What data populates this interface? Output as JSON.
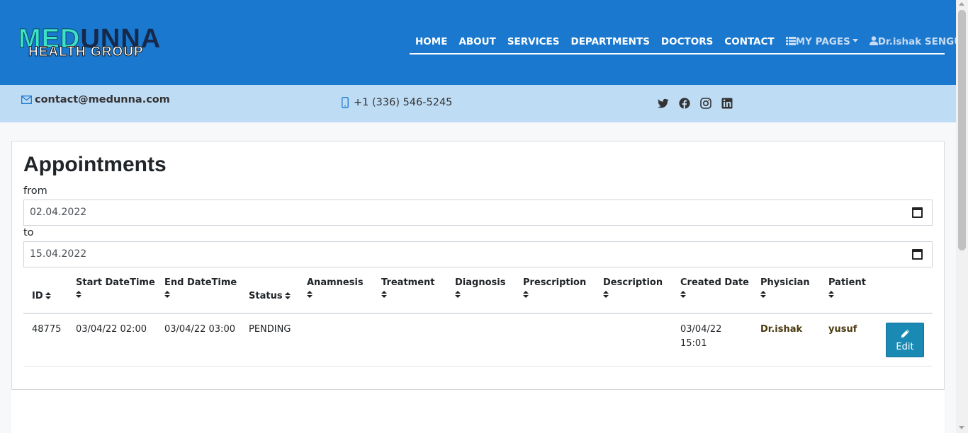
{
  "brand": {
    "logo_top_a": "MED",
    "logo_top_b": "UNNA",
    "logo_bottom": "HEALTH GROUP"
  },
  "nav": {
    "items": [
      "HOME",
      "ABOUT",
      "SERVICES",
      "DEPARTMENTS",
      "DOCTORS",
      "CONTACT"
    ],
    "my_pages": "MY PAGES",
    "user": "Dr.ishak SENGUL"
  },
  "contact": {
    "email": "contact@medunna.com",
    "phone": "+1 (336) 546-5245",
    "socials": [
      "twitter-icon",
      "facebook-icon",
      "instagram-icon",
      "linkedin-icon"
    ]
  },
  "page": {
    "title": "Appointments",
    "from_label": "from",
    "from_value": "02.04.2022",
    "to_label": "to",
    "to_value": "15.04.2022"
  },
  "table": {
    "headers": [
      "ID",
      "Start DateTime",
      "End DateTime",
      "Status",
      "Anamnesis",
      "Treatment",
      "Diagnosis",
      "Prescription",
      "Description",
      "Created Date",
      "Physician",
      "Patient"
    ],
    "rows": [
      {
        "id": "48775",
        "start": "03/04/22 02:00",
        "end": "03/04/22 03:00",
        "status": "PENDING",
        "anamnesis": "",
        "treatment": "",
        "diagnosis": "",
        "prescription": "",
        "description": "",
        "created_date": "03/04/22",
        "created_time": "15:01",
        "physician": "Dr.ishak",
        "patient": "yusuf",
        "action": "Edit"
      }
    ]
  },
  "colors": {
    "header_bg": "#1a78cf",
    "contact_bg": "#bfdcf5",
    "edit_button": "#1a8ab5"
  }
}
